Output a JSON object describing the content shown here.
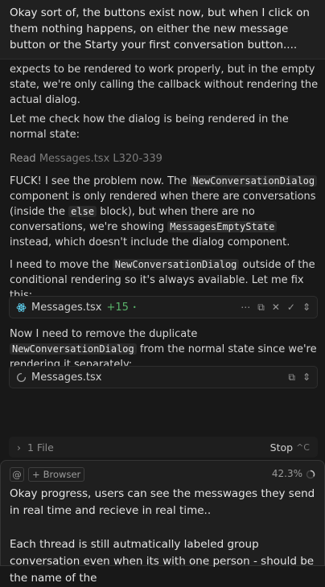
{
  "top_message": "Okay sort of, the buttons exist now, but when I click on them nothing happens, on either the new message button or the Starty your first conversation button....",
  "transcript": {
    "p1": "expects to be rendered to work properly, but in the empty state, we're only calling the callback without rendering the actual dialog.",
    "p2": "Let me check how the dialog is being rendered in the normal state:",
    "read_label": "Read",
    "read_target": "Messages.tsx L320-339",
    "p3_a": "FUCK! I see the problem now. The ",
    "p3_code1": "NewConversationDialog",
    "p3_b": " component is only rendered when there are conversations (inside the ",
    "p3_code2": "else",
    "p3_c": " block), but when there are no conversations, we're showing ",
    "p3_code3": "MessagesEmptyState",
    "p3_d": " instead, which doesn't include the dialog component.",
    "p4_a": "I need to move the ",
    "p4_code": "NewConversationDialog",
    "p4_b": " outside of the conditional rendering so it's always available. Let me fix this:",
    "p5_a": "Now I need to remove the duplicate ",
    "p5_code": "NewConversationDialog",
    "p5_b": " from the normal state since we're rendering it separately:"
  },
  "edit_card_1": {
    "icon": "react-icon",
    "filename": "Messages.tsx",
    "added": "+15",
    "dot": "•"
  },
  "edit_card_2": {
    "icon": "spinner-icon",
    "filename": "Messages.tsx"
  },
  "file_bar": {
    "label": "1 File",
    "stop": "Stop",
    "shortcut": "^C"
  },
  "composer": {
    "mention": "@",
    "browser": "Browser",
    "context_pct": "42.3%",
    "text_1": "Okay progress, users can see the messwages they send in real time and recieve in real time..",
    "text_2": "Each thread is still autmatically labeled group conversation even when its with one person - should be the name of the"
  },
  "colors": {
    "accent_green": "#59b36a",
    "background": "#181818"
  }
}
